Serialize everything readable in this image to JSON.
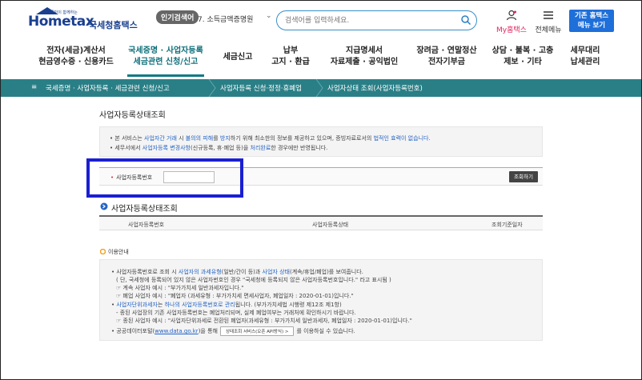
{
  "header": {
    "logo_top": "국민이 함께하는",
    "logo_word": "Hometax",
    "logo_sub": "국세청홈택스",
    "popular_badge": "인기검색어",
    "popular_term": "7.  소득금액증명원",
    "search_placeholder": "검색어를 입력하세요.",
    "my_home_label": "My홈택스",
    "all_menu_label": "전체메뉴",
    "legacy_line1": "기존 홈택스",
    "legacy_line2": "메뉴 보기"
  },
  "nav": {
    "items": [
      {
        "line1": "전자(세금)계산서",
        "line2": "현금영수증 · 신용카드"
      },
      {
        "line1": "국세증명 · 사업자등록",
        "line2": "세금관련 신청/신고"
      },
      {
        "line1": "세금신고",
        "line2": ""
      },
      {
        "line1": "납부",
        "line2": "고지 · 환급"
      },
      {
        "line1": "지급명세서",
        "line2": "자료제출 · 공익법인"
      },
      {
        "line1": "장려금 · 연말정산",
        "line2": "전자기부금"
      },
      {
        "line1": "상담 · 불복 · 고충",
        "line2": "제보 · 기타"
      },
      {
        "line1": "세무대리",
        "line2": "납세관리"
      }
    ]
  },
  "breadcrumb": {
    "item1": "국세증명 · 사업자등록 · 세금관련 신청/신고",
    "item2": "사업자등록 신청·정정·휴폐업",
    "item3": "사업자상태 조회(사업자등록번호)"
  },
  "page": {
    "title": "사업자등록상태조회",
    "info1_a": "• 본 서비스는 ",
    "info1_b": "사업자간 거래",
    "info1_c": " 시 ",
    "info1_d": "불의의 피해",
    "info1_e": "를 ",
    "info1_f": "방지",
    "info1_g": "하기 위해 최소한의 정보를 제공하고 있으며, 증빙자료로서의 ",
    "info1_h": "법적인 효력이 없습니다.",
    "info2_a": "• 세무서에서 ",
    "info2_b": "사업자등록 변경사항",
    "info2_c": "(신규등록, 휴·폐업 등)을 ",
    "info2_d": "처리완료",
    "info2_e": "한 경우에만 반영됩니다.",
    "form_label": "사업자등록번호",
    "query_button": "조회하기",
    "section_title": "사업자등록상태조회",
    "col1": "사업자등록번호",
    "col2": "사업자등록상태",
    "col3": "조회기준일자",
    "guide_title": "이용안내",
    "g1_a": "• 사업자등록번호로 조회 시 ",
    "g1_b": "사업자의 과세유형",
    "g1_c": "(일반/간이 등)과 ",
    "g1_d": "사업자 상태",
    "g1_e": "(계속/휴업/폐업)를 보여줍니다.",
    "g2": "( 단, 국세청에 등록되어 있지 않은 사업자번호인 경우 \"국세청에 등록되지 않은 사업자등록번호입니다.\" 라고 표시됨 )",
    "g3": "☞ 계속 사업자 예시 : \"부가가치세 일반과세자입니다.\"",
    "g4": "☞ 폐업 사업자 예시 : \"폐업자 (과세유형 : 부가가치세 면세사업자, 폐업일자 : 2020-01-01)입니다.\"",
    "g5_a": "• ",
    "g5_b": "사업자단위과세자",
    "g5_c": "는 ",
    "g5_d": "하나의 사업자등록번호로 관리",
    "g5_e": "됩니다. (부가가치세법 시행령 제12조 제1항)",
    "g6": "- 종된 사업장의 기존 사업자등록번호는 폐업처리되며, 실제 폐업여부는 거래처에 확인하시기 바랍니다.",
    "g7": "☞ 종된 사업자 예시 : \"사업자단위과세로 전환된 폐업자(과세유형 : 부가가치세 일반과세자, 폐업일자 : 2020-01-01)입니다.\"",
    "g8_a": "• 공공데이터포털(",
    "g8_b": "www.data.go.kr",
    "g8_c": ")을 통해",
    "g8_btn": "상태조회 서비스(오픈 API방식)  >",
    "g8_d": "를 이용하실 수 있습니다."
  },
  "colors": {
    "brand": "#1a3f8f",
    "nav_active": "#0e6f7a",
    "breadcrumb_bg": "#2a7f86",
    "highlight": "#1a1fd1",
    "link": "#2463c4",
    "warning": "#d23a3a"
  }
}
